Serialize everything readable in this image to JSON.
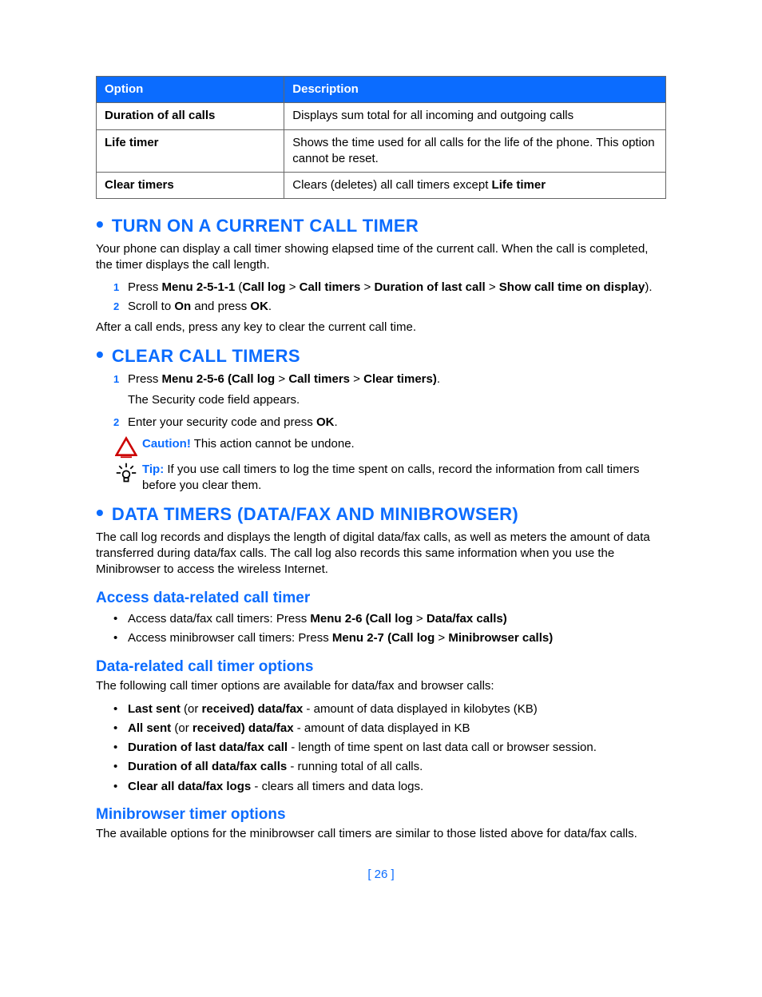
{
  "table": {
    "headers": {
      "option": "Option",
      "description": "Description"
    },
    "rows": [
      {
        "option": "Duration of all calls",
        "description": "Displays sum total for all incoming and outgoing calls"
      },
      {
        "option": "Life timer",
        "description": "Shows the time used for all calls for the life of the phone. This option cannot be reset."
      },
      {
        "option": "Clear timers",
        "desc_pre": "Clears (deletes) all call timers except ",
        "desc_bold": "Life timer"
      }
    ]
  },
  "s1": {
    "title": "TURN ON A CURRENT CALL TIMER",
    "intro": "Your phone can display a call timer showing elapsed time of the current call. When the call is completed, the timer displays the call length.",
    "step1_pre": "Press ",
    "step1_b1": "Menu 2-5-1-1",
    "step1_mid1": " (",
    "step1_b2": "Call log",
    "step1_gt1": " > ",
    "step1_b3": "Call timers",
    "step1_gt2": " > ",
    "step1_b4": "Duration of last call",
    "step1_gt3": " > ",
    "step1_b5": "Show call time on display",
    "step1_end": ").",
    "step2_pre": "Scroll to ",
    "step2_b1": "On",
    "step2_mid": " and press ",
    "step2_b2": "OK",
    "step2_end": ".",
    "after": "After a call ends, press any key to clear the current call time."
  },
  "s2": {
    "title": "CLEAR CALL TIMERS",
    "step1_pre": "Press ",
    "step1_b1": "Menu 2-5-6 (Call log",
    "step1_gt1": " > ",
    "step1_b2": "Call timers",
    "step1_gt2": " > ",
    "step1_b3": "Clear timers)",
    "step1_end": ".",
    "step1_note": "The Security code field appears.",
    "step2_pre": "Enter your security code and press ",
    "step2_b1": "OK",
    "step2_end": ".",
    "caution_label": "Caution!",
    "caution_text": " This action cannot be undone.",
    "tip_label": "Tip:",
    "tip_text": " If you use call timers to log the time spent on calls, record the information from call timers before you clear them."
  },
  "s3": {
    "title": "DATA TIMERS (DATA/FAX AND MINIBROWSER)",
    "intro": "The call log records and displays the length of digital data/fax calls, as well as meters the amount of data transferred during data/fax calls. The call log also records this same information when you use the Minibrowser to access the wireless Internet.",
    "sub1": "Access data-related call timer",
    "a1_pre": "Access data/fax call timers: Press ",
    "a1_b1": "Menu 2-6 (Call log",
    "a1_gt": " > ",
    "a1_b2": "Data/fax calls)",
    "a2_pre": "Access minibrowser call timers: Press ",
    "a2_b1": "Menu 2-7 (Call log",
    "a2_gt": " > ",
    "a2_b2": "Minibrowser calls)",
    "sub2": "Data-related call timer options",
    "opts_intro": "The following call timer options are available for data/fax and browser calls:",
    "o1_b1": "Last sent",
    "o1_m1": " (or ",
    "o1_b2": "received) data/fax",
    "o1_rest": " - amount of data displayed in kilobytes (KB)",
    "o2_b1": "All sent",
    "o2_m1": " (or ",
    "o2_b2": "received) data/fax",
    "o2_rest": " - amount of data displayed in KB",
    "o3_b1": "Duration of last data/fax call",
    "o3_rest": " - length of time spent on last data call or browser session.",
    "o4_b1": "Duration of all data/fax calls",
    "o4_rest": " - running total of all calls.",
    "o5_b1": "Clear all data/fax logs",
    "o5_rest": " - clears all timers and data logs.",
    "sub3": "Minibrowser timer options",
    "mini_text": "The available options for the minibrowser call timers are similar to those listed above for data/fax calls."
  },
  "page_number": "[ 26 ]"
}
